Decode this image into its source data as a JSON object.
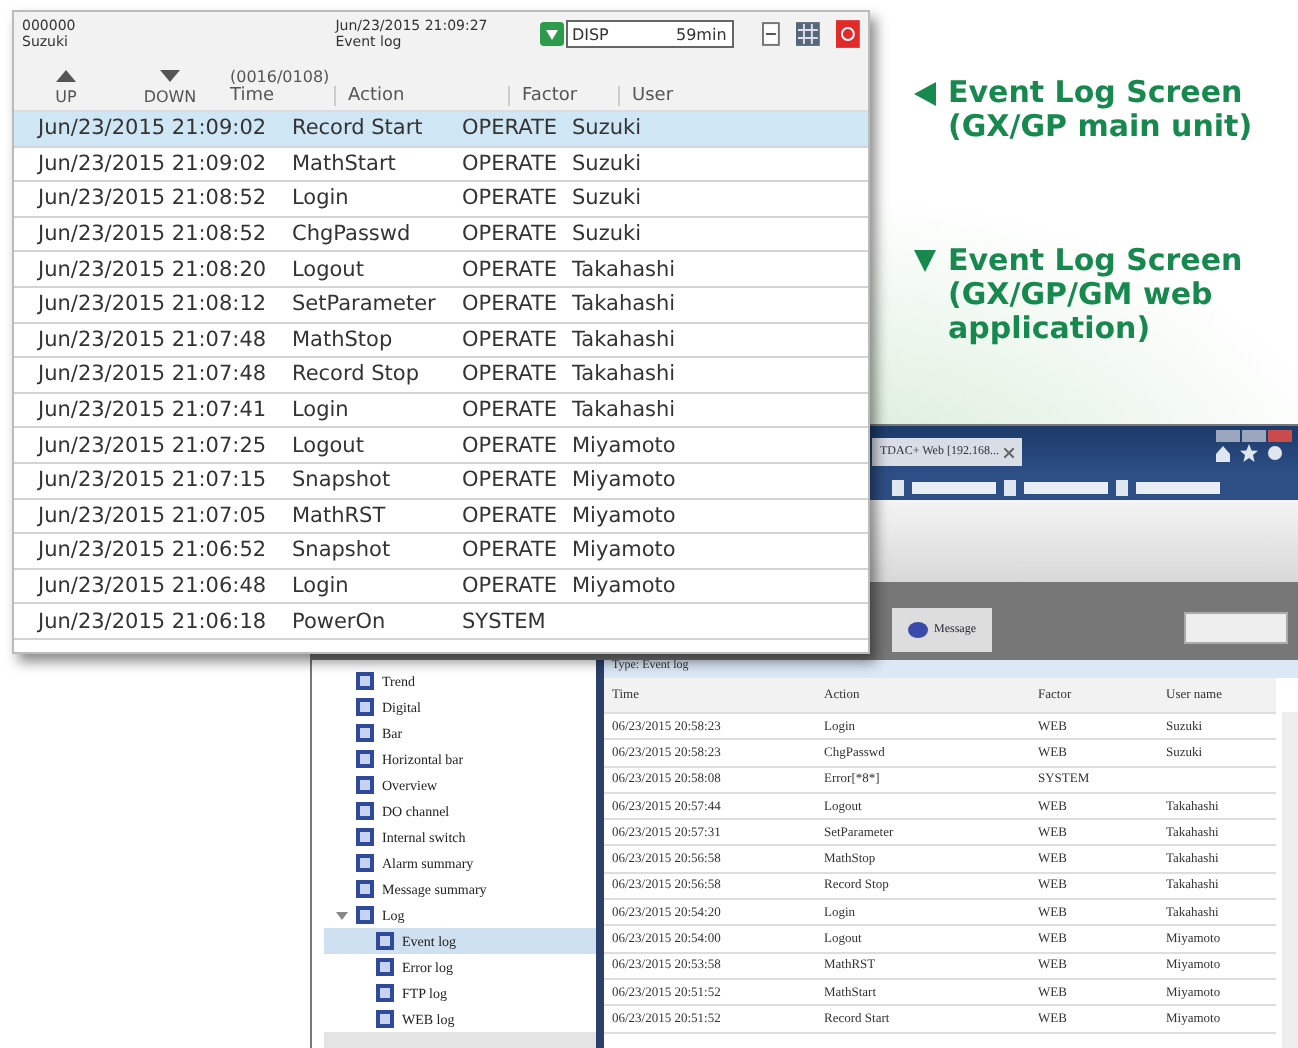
{
  "captions": [
    {
      "kind": "left",
      "text": "Event Log Screen\n(GX/GP main unit)"
    },
    {
      "kind": "down",
      "text": "Event Log Screen\n(GX/GP/GM web\napplication)"
    }
  ],
  "main_unit": {
    "header": {
      "user_id": "000000",
      "user": "Suzuki",
      "datetime": "Jun/23/2015 21:09:27",
      "screen": "Event log",
      "disp_label": "DISP",
      "disp_time": "59min"
    },
    "nav": {
      "up": "UP",
      "down": "DOWN",
      "counter": "(0016/0108)"
    },
    "columns": [
      "Time",
      "Action",
      "Factor",
      "User"
    ],
    "rows": [
      {
        "selected": true,
        "cells": [
          "Jun/23/2015 21:09:02",
          "Record Start",
          "OPERATE",
          "Suzuki"
        ]
      },
      {
        "selected": false,
        "cells": [
          "Jun/23/2015 21:09:02",
          "MathStart",
          "OPERATE",
          "Suzuki"
        ]
      },
      {
        "selected": false,
        "cells": [
          "Jun/23/2015 21:08:52",
          "Login",
          "OPERATE",
          "Suzuki"
        ]
      },
      {
        "selected": false,
        "cells": [
          "Jun/23/2015 21:08:52",
          "ChgPasswd",
          "OPERATE",
          "Suzuki"
        ]
      },
      {
        "selected": false,
        "cells": [
          "Jun/23/2015 21:08:20",
          "Logout",
          "OPERATE",
          "Takahashi"
        ]
      },
      {
        "selected": false,
        "cells": [
          "Jun/23/2015 21:08:12",
          "SetParameter",
          "OPERATE",
          "Takahashi"
        ]
      },
      {
        "selected": false,
        "cells": [
          "Jun/23/2015 21:07:48",
          "MathStop",
          "OPERATE",
          "Takahashi"
        ]
      },
      {
        "selected": false,
        "cells": [
          "Jun/23/2015 21:07:48",
          "Record Stop",
          "OPERATE",
          "Takahashi"
        ]
      },
      {
        "selected": false,
        "cells": [
          "Jun/23/2015 21:07:41",
          "Login",
          "OPERATE",
          "Takahashi"
        ]
      },
      {
        "selected": false,
        "cells": [
          "Jun/23/2015 21:07:25",
          "Logout",
          "OPERATE",
          "Miyamoto"
        ]
      },
      {
        "selected": false,
        "cells": [
          "Jun/23/2015 21:07:15",
          "Snapshot",
          "OPERATE",
          "Miyamoto"
        ]
      },
      {
        "selected": false,
        "cells": [
          "Jun/23/2015 21:07:05",
          "MathRST",
          "OPERATE",
          "Miyamoto"
        ]
      },
      {
        "selected": false,
        "cells": [
          "Jun/23/2015 21:06:52",
          "Snapshot",
          "OPERATE",
          "Miyamoto"
        ]
      },
      {
        "selected": false,
        "cells": [
          "Jun/23/2015 21:06:48",
          "Login",
          "OPERATE",
          "Miyamoto"
        ]
      },
      {
        "selected": false,
        "cells": [
          "Jun/23/2015 21:06:18",
          "PowerOn",
          "SYSTEM",
          ""
        ]
      }
    ]
  },
  "web_app": {
    "browser_tab": "TDAC+ Web [192.168...",
    "active_tab": "Message",
    "tree": [
      {
        "label": "Trend",
        "selected": false
      },
      {
        "label": "Digital",
        "selected": false
      },
      {
        "label": "Bar",
        "selected": false
      },
      {
        "label": "Horizontal bar",
        "selected": false
      },
      {
        "label": "Overview",
        "selected": false
      },
      {
        "label": "DO channel",
        "selected": false
      },
      {
        "label": "Internal switch",
        "selected": false
      },
      {
        "label": "Alarm summary",
        "selected": false
      },
      {
        "label": "Message summary",
        "selected": false
      },
      {
        "label": "Log",
        "selected": false,
        "expanded": true,
        "children": [
          {
            "label": "Event log",
            "selected": true
          },
          {
            "label": "Error log",
            "selected": false
          },
          {
            "label": "FTP log",
            "selected": false
          },
          {
            "label": "WEB log",
            "selected": false
          }
        ]
      }
    ],
    "log_type": "Type: Event log",
    "columns": [
      "Time",
      "Action",
      "Factor",
      "User name"
    ],
    "rows": [
      [
        "06/23/2015 20:58:23",
        "Login",
        "WEB",
        "Suzuki"
      ],
      [
        "06/23/2015 20:58:23",
        "ChgPasswd",
        "WEB",
        "Suzuki"
      ],
      [
        "06/23/2015 20:58:08",
        "Error[*8*]",
        "SYSTEM",
        ""
      ],
      [
        "06/23/2015 20:57:44",
        "Logout",
        "WEB",
        "Takahashi"
      ],
      [
        "06/23/2015 20:57:31",
        "SetParameter",
        "WEB",
        "Takahashi"
      ],
      [
        "06/23/2015 20:56:58",
        "MathStop",
        "WEB",
        "Takahashi"
      ],
      [
        "06/23/2015 20:56:58",
        "Record Stop",
        "WEB",
        "Takahashi"
      ],
      [
        "06/23/2015 20:54:20",
        "Login",
        "WEB",
        "Takahashi"
      ],
      [
        "06/23/2015 20:54:00",
        "Logout",
        "WEB",
        "Miyamoto"
      ],
      [
        "06/23/2015 20:53:58",
        "MathRST",
        "WEB",
        "Miyamoto"
      ],
      [
        "06/23/2015 20:51:52",
        "MathStart",
        "WEB",
        "Miyamoto"
      ],
      [
        "06/23/2015 20:51:52",
        "Record Start",
        "WEB",
        "Miyamoto"
      ]
    ]
  }
}
